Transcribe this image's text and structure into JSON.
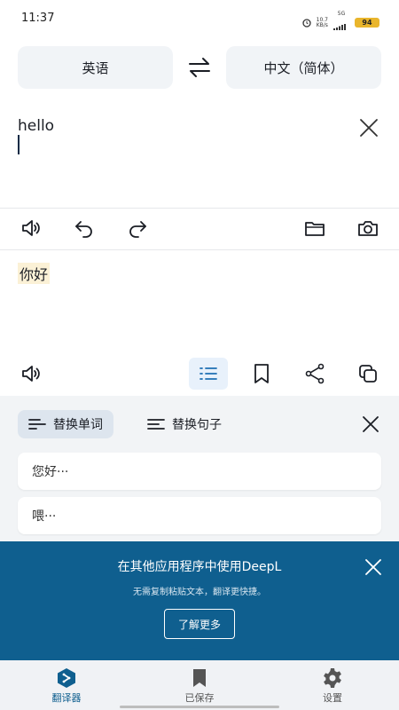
{
  "status": {
    "time": "11:37",
    "net_speed": "10.7",
    "net_unit": "KB/s",
    "signal_label": "5G",
    "battery": "94"
  },
  "languages": {
    "source": "英语",
    "target": "中文（简体）"
  },
  "input": {
    "text": "hello"
  },
  "result": {
    "text": "你好"
  },
  "alternatives": {
    "tab_word": "替换单词",
    "tab_sentence": "替换句子",
    "items": [
      "您好···",
      "喂···"
    ]
  },
  "promo": {
    "title": "在其他应用程序中使用DeepL",
    "subtitle": "无需复制粘贴文本，翻译更快捷。",
    "button": "了解更多"
  },
  "nav": {
    "translator": "翻译器",
    "saved": "已保存",
    "settings": "设置"
  },
  "colors": {
    "accent": "#0f5f8f",
    "lang_bg": "#f1f4f7",
    "highlight": "#fbf1d6"
  }
}
